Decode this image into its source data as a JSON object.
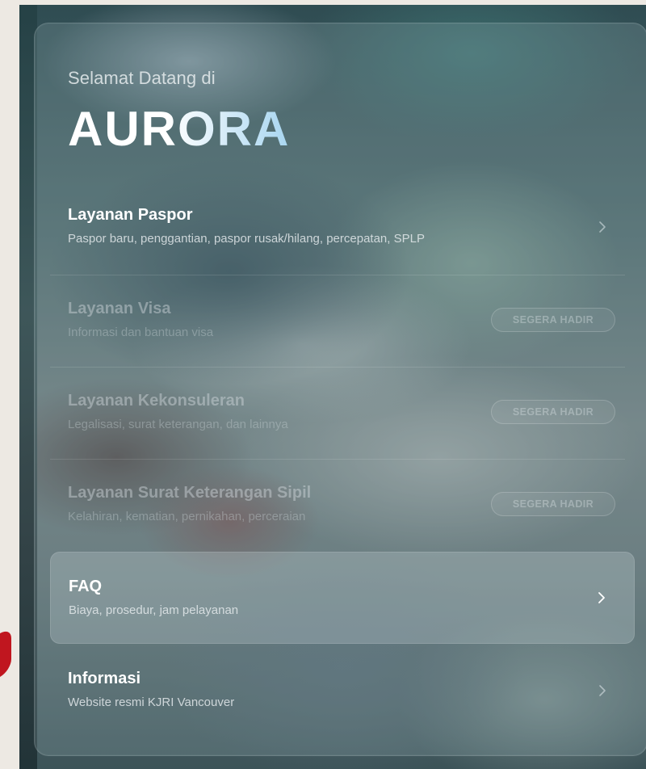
{
  "header": {
    "welcome": "Selamat Datang di",
    "brand": "AURORA"
  },
  "menu": [
    {
      "title": "Layanan Paspor",
      "description": "Paspor baru, penggantian, paspor rusak/hilang, percepatan, SPLP",
      "status": "available",
      "icon": "chevron-right-icon"
    },
    {
      "title": "Layanan Visa",
      "description": "Informasi dan bantuan visa",
      "status": "coming-soon",
      "badge": "SEGERA HADIR"
    },
    {
      "title": "Layanan Kekonsuleran",
      "description": "Legalisasi, surat keterangan, dan lainnya",
      "status": "coming-soon",
      "badge": "SEGERA HADIR"
    },
    {
      "title": "Layanan Surat Keterangan Sipil",
      "description": "Kelahiran, kematian, pernikahan, perceraian",
      "status": "coming-soon",
      "badge": "SEGERA HADIR"
    },
    {
      "title": "FAQ",
      "description": "Biaya, prosedur, jam pelayanan",
      "status": "available",
      "highlighted": true,
      "icon": "chevron-right-icon"
    },
    {
      "title": "Informasi",
      "description": "Website resmi KJRI Vancouver",
      "status": "available",
      "icon": "chevron-right-icon"
    }
  ],
  "colors": {
    "page_background": "#ede9e3",
    "accent_red": "#c0161f",
    "text_primary": "#ffffff"
  }
}
